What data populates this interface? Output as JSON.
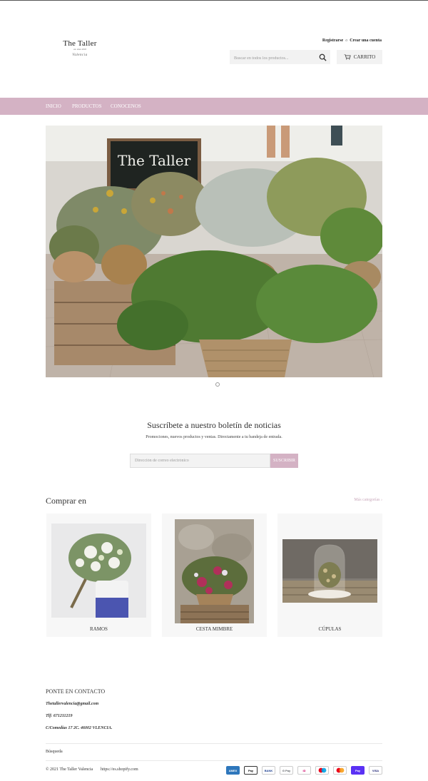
{
  "header": {
    "logo": {
      "title": "The Taller",
      "tagline": "est. since 2018",
      "city": "Valencia"
    },
    "account": {
      "register": "Registrarse",
      "or": "o",
      "create": "Crear una cuenta"
    },
    "search": {
      "placeholder": "Buscar en todos los productos..."
    },
    "cart": {
      "label": "CARRITO",
      "icon": "cart-icon"
    }
  },
  "nav": {
    "items": [
      "INICIO",
      "PRODUCTOS",
      "CONOCENOS"
    ]
  },
  "hero": {
    "sign_text": "The Taller"
  },
  "newsletter": {
    "title": "Suscríbete a nuestro boletín de noticias",
    "description": "Promociones, nuevos productos y ventas. Directamente a tu bandeja de entrada.",
    "placeholder": "Dirección de correo electrónico",
    "button": "SUSCRIBIR"
  },
  "collections": {
    "heading": "Comprar en",
    "more_link": "Más categorías ›",
    "items": [
      {
        "label": "RAMOS"
      },
      {
        "label": "CESTA MIMBRE"
      },
      {
        "label": "CÚPULAS"
      }
    ]
  },
  "footer": {
    "contact_heading": "PONTE EN CONTACTO",
    "email": "Thetallervalencia@gmail.com",
    "phone": "Tlf: 671211219",
    "address": "C/Comedias 17 2C. 46002 VLENCIA.",
    "search_link": "Búsqueda",
    "copyright": "© 2021 The Taller Valencia",
    "powered": "https://es.shopify.com",
    "payments": [
      "AMEX",
      "Pay",
      "BANK",
      "G Pay",
      "iD",
      "",
      "",
      "Pay",
      "VISA"
    ]
  },
  "colors": {
    "accent": "#d4b2c4",
    "nav_text": "#ffffff",
    "page_bg": "#ffffff"
  }
}
